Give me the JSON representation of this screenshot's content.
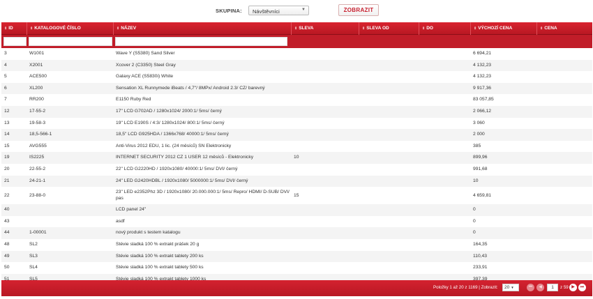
{
  "filter": {
    "group_label": "SKUPINA:",
    "group_value": "Návštěvníci",
    "show_button": "ZOBRAZIT"
  },
  "table": {
    "columns": [
      {
        "key": "id",
        "label": "ID",
        "sortable": true
      },
      {
        "key": "catalog",
        "label": "KATALOGOVÉ ČÍSLO",
        "sortable": true
      },
      {
        "key": "name",
        "label": "NÁZEV",
        "sortable": true
      },
      {
        "key": "discount",
        "label": "SLEVA",
        "sortable": true
      },
      {
        "key": "discount_from",
        "label": "SLEVA OD",
        "sortable": true
      },
      {
        "key": "discount_to",
        "label": "DO",
        "sortable": true
      },
      {
        "key": "base_price",
        "label": "VÝCHOZÍ CENA",
        "sortable": true
      },
      {
        "key": "price",
        "label": "CENA",
        "sortable": true
      }
    ],
    "rows": [
      {
        "id": "3",
        "catalog": "W1001",
        "name": "Wave Y (S5380) Sand Silver",
        "discount": "",
        "discount_from": "",
        "discount_to": "",
        "base_price": "6 694,21",
        "price": ""
      },
      {
        "id": "4",
        "catalog": "X2001",
        "name": "Xcover 2 (C3350) Steel Gray",
        "discount": "",
        "discount_from": "",
        "discount_to": "",
        "base_price": "4 132,23",
        "price": ""
      },
      {
        "id": "5",
        "catalog": "ACE500",
        "name": "Galaxy ACE (S5830i) White",
        "discount": "",
        "discount_from": "",
        "discount_to": "",
        "base_price": "4 132,23",
        "price": ""
      },
      {
        "id": "6",
        "catalog": "XL200",
        "name": "Sensation XL Runnymede iBeats / 4,7\"/ 8MPx/ Android 2.3/ CZ/ barevný",
        "discount": "",
        "discount_from": "",
        "discount_to": "",
        "base_price": "9 917,36",
        "price": ""
      },
      {
        "id": "7",
        "catalog": "RR200",
        "name": "E1150 Ruby Red",
        "discount": "",
        "discount_from": "",
        "discount_to": "",
        "base_price": "83 057,85",
        "price": ""
      },
      {
        "id": "12",
        "catalog": "17-55-2",
        "name": "17\" LCD G702AD / 1280x1024/ 2000:1/ 5ms/ černý",
        "discount": "",
        "discount_from": "",
        "discount_to": "",
        "base_price": "2 066,12",
        "price": ""
      },
      {
        "id": "13",
        "catalog": "19-58-3",
        "name": "19\" LCD E190S / 4:3/ 1280x1024/ 800:1/ 5ms/ černý",
        "discount": "",
        "discount_from": "",
        "discount_to": "",
        "base_price": "3 060",
        "price": ""
      },
      {
        "id": "14",
        "catalog": "18,5-566-1",
        "name": "18,5\" LCD G925HDA / 1366x768/ 40000:1/ 5ms/ černý",
        "discount": "",
        "discount_from": "",
        "discount_to": "",
        "base_price": "2 000",
        "price": ""
      },
      {
        "id": "15",
        "catalog": "AVG555",
        "name": "Anti-Virus 2012 EDU, 1 lic. (24 měsíců) SN Elektronicky",
        "discount": "",
        "discount_from": "",
        "discount_to": "",
        "base_price": "385",
        "price": ""
      },
      {
        "id": "19",
        "catalog": "IS2225",
        "name": "INTERNET SECURITY 2012 CZ 1 USER 12 měsíců - Elektronicky",
        "discount": "10",
        "discount_from": "",
        "discount_to": "",
        "base_price": "899,96",
        "price": ""
      },
      {
        "id": "20",
        "catalog": "22-55-2",
        "name": "22\" LCD G2220HD / 1920x1080/ 40000:1/ 5ms/ DVI/ černý",
        "discount": "",
        "discount_from": "",
        "discount_to": "",
        "base_price": "991,68",
        "price": ""
      },
      {
        "id": "21",
        "catalog": "24-21-1",
        "name": "24\" LED G2420HDBL / 1920x1080/ 5000000:1/ 5ms/ DVI/ černý",
        "discount": "",
        "discount_from": "",
        "discount_to": "",
        "base_price": "10",
        "price": ""
      },
      {
        "id": "22",
        "catalog": "23-88-0",
        "name": "23\" LED e2352Phz 3D / 1920x1080/ 20.000.000:1/ 5ms/ Repro/ HDMI/ D-SUB/ DVI/ pas",
        "discount": "15",
        "discount_from": "",
        "discount_to": "",
        "base_price": "4 659,81",
        "price": ""
      },
      {
        "id": "40",
        "catalog": "",
        "name": "LCD panel 24\"",
        "discount": "",
        "discount_from": "",
        "discount_to": "",
        "base_price": "0",
        "price": ""
      },
      {
        "id": "43",
        "catalog": "",
        "name": "asdf",
        "discount": "",
        "discount_from": "",
        "discount_to": "",
        "base_price": "0",
        "price": ""
      },
      {
        "id": "44",
        "catalog": "1-00001",
        "name": "nový produkt s testem katalogu",
        "discount": "",
        "discount_from": "",
        "discount_to": "",
        "base_price": "0",
        "price": ""
      },
      {
        "id": "48",
        "catalog": "SL2",
        "name": "Stévie sladká 100 % extrakt prášek 20 g",
        "discount": "",
        "discount_from": "",
        "discount_to": "",
        "base_price": "164,35",
        "price": ""
      },
      {
        "id": "49",
        "catalog": "SL3",
        "name": "Stévie sladká 100 % extrakt tablety 200 ks",
        "discount": "",
        "discount_from": "",
        "discount_to": "",
        "base_price": "110,43",
        "price": ""
      },
      {
        "id": "50",
        "catalog": "SL4",
        "name": "Stévie sladká 100 % extrakt tablety 500 ks",
        "discount": "",
        "discount_from": "",
        "discount_to": "",
        "base_price": "233,91",
        "price": ""
      },
      {
        "id": "51",
        "catalog": "SL5",
        "name": "Stévie sladká 100 % extrakt tablety 1000 ks",
        "discount": "",
        "discount_from": "",
        "discount_to": "",
        "base_price": "397,39",
        "price": ""
      }
    ]
  },
  "pager": {
    "info": "Položky 1 až 20 z 1169 | Zobrazit:",
    "page_size": "20",
    "current_page": "1",
    "of_pages": "z 59"
  },
  "icons": {
    "sort": "sort-icon",
    "dropdown": "chevron-down-icon",
    "first": "first-page-icon",
    "prev": "prev-page-icon",
    "next": "next-page-icon",
    "last": "last-page-icon"
  },
  "colors": {
    "header_red": "#c11d29",
    "accent_red": "#d9232f",
    "button_text": "#c8202f"
  }
}
